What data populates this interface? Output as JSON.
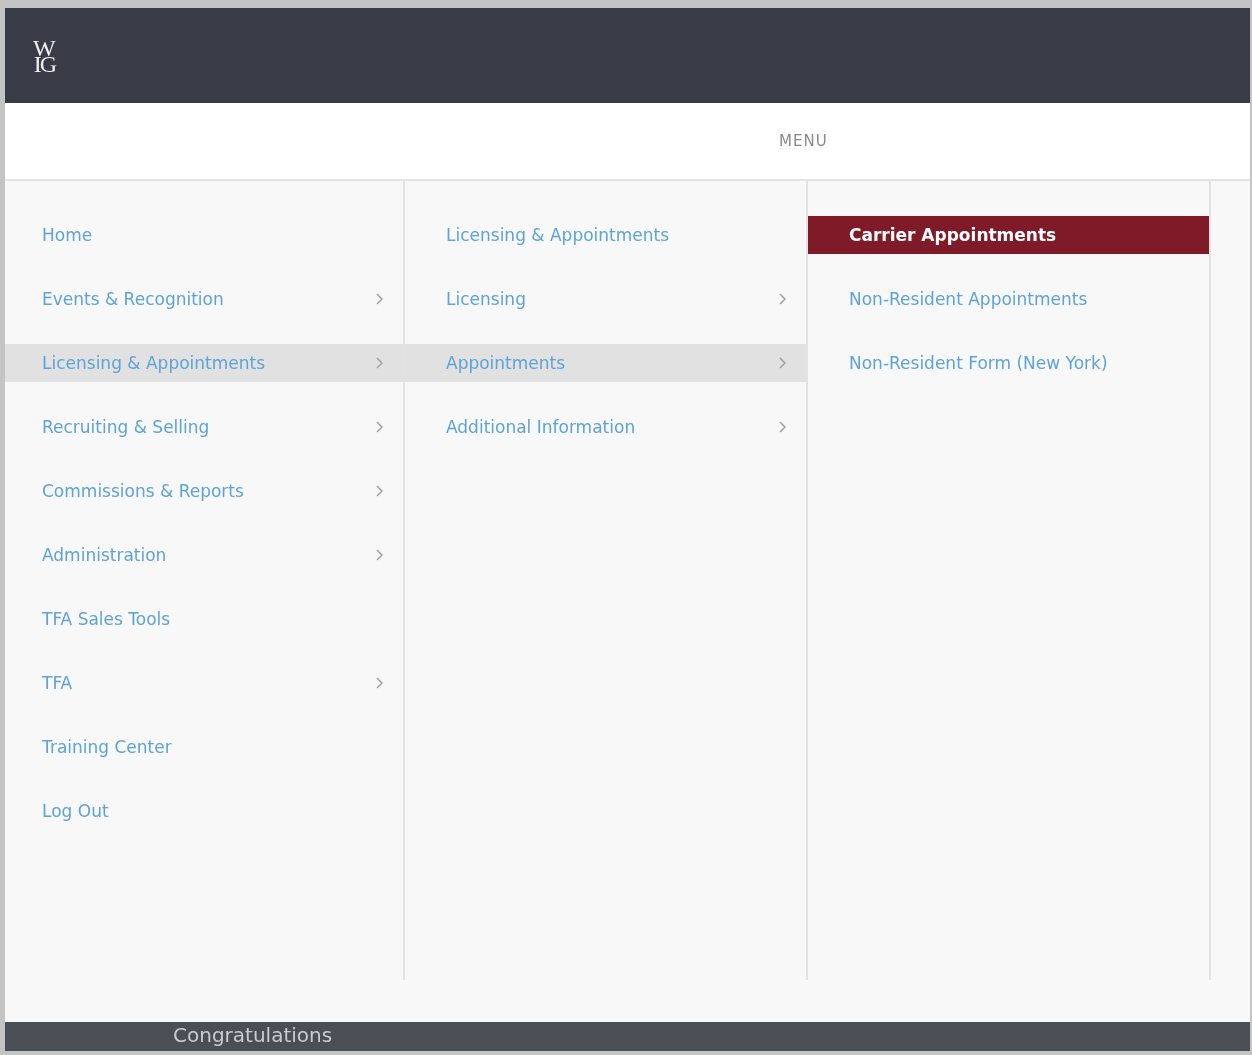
{
  "header": {
    "logo": {
      "top": "W",
      "bottom": "IG"
    }
  },
  "menu": {
    "title": "MENU",
    "columns": [
      {
        "items": [
          {
            "label": "Home",
            "has_submenu": false,
            "selected": false
          },
          {
            "label": "Events & Recognition",
            "has_submenu": true,
            "selected": false
          },
          {
            "label": "Licensing & Appointments",
            "has_submenu": true,
            "selected": true
          },
          {
            "label": "Recruiting & Selling",
            "has_submenu": true,
            "selected": false
          },
          {
            "label": "Commissions & Reports",
            "has_submenu": true,
            "selected": false
          },
          {
            "label": "Administration",
            "has_submenu": true,
            "selected": false
          },
          {
            "label": "TFA Sales Tools",
            "has_submenu": false,
            "selected": false
          },
          {
            "label": "TFA",
            "has_submenu": true,
            "selected": false
          },
          {
            "label": "Training Center",
            "has_submenu": false,
            "selected": false
          },
          {
            "label": "Log Out",
            "has_submenu": false,
            "selected": false
          }
        ]
      },
      {
        "items": [
          {
            "label": "Licensing & Appointments",
            "has_submenu": false,
            "selected": false
          },
          {
            "label": "Licensing",
            "has_submenu": true,
            "selected": false
          },
          {
            "label": "Appointments",
            "has_submenu": true,
            "selected": true
          },
          {
            "label": "Additional Information",
            "has_submenu": true,
            "selected": false
          }
        ]
      },
      {
        "items": [
          {
            "label": "Carrier Appointments",
            "has_submenu": false,
            "selected": true
          },
          {
            "label": "Non-Resident Appointments",
            "has_submenu": false,
            "selected": false
          },
          {
            "label": "Non-Resident Form (New York)",
            "has_submenu": false,
            "selected": false
          }
        ]
      }
    ]
  },
  "background": {
    "heading": "Congratulations"
  }
}
